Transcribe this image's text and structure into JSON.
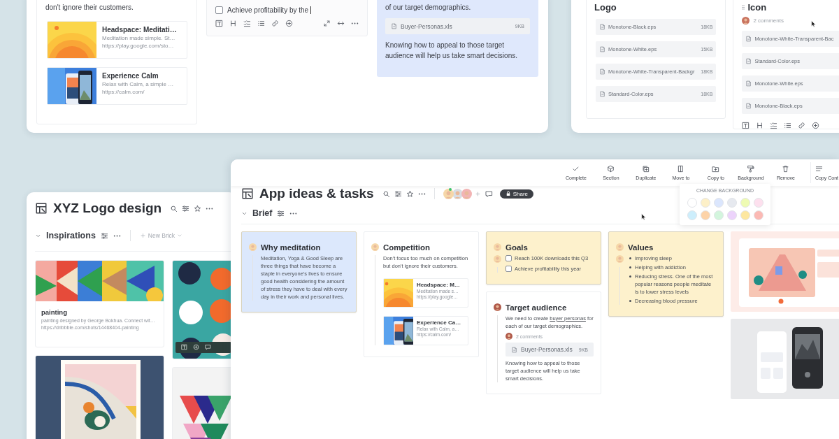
{
  "top_left_window": {
    "competition_card": {
      "text": "don't ignore their customers.",
      "links": [
        {
          "title": "Headspace: Meditati…",
          "description": "Meditation made simple. St…",
          "url": "https://play.google.com/sto…",
          "thumbnail": {
            "kind": "picture"
          }
        },
        {
          "title": "Experience Calm",
          "description": "Relax with Calm, a simple …",
          "url": "https://calm.com/",
          "thumbnail": {
            "kind": "picture"
          }
        }
      ]
    },
    "goals_card": {
      "tasks": [
        {
          "label": "Achieve profitability by the",
          "checked": false,
          "editing": true
        }
      ]
    },
    "target_card": {
      "color": "#dfe8fc",
      "text": "of our target demographics.",
      "attachment": {
        "name": "Buyer-Personas.xls",
        "size": "9KB"
      },
      "note": "Knowing how to appeal to those target audience will help us take smart decisions."
    }
  },
  "top_right_window": {
    "columns": [
      {
        "title": "Logo",
        "files": [
          {
            "name": "Monotone-Black.eps",
            "size": "18KB"
          },
          {
            "name": "Monotone-White.eps",
            "size": "15KB"
          },
          {
            "name": "Monotone-White-Transparent-Backgr",
            "size": "18KB"
          },
          {
            "name": "Standard-Color.eps",
            "size": "18KB"
          }
        ]
      },
      {
        "title": "Icon",
        "comments": "2 comments",
        "files": [
          {
            "name": "Monotone-White-Transparent-Bac"
          },
          {
            "name": "Standard-Color.eps"
          },
          {
            "name": "Monotone-White.eps"
          },
          {
            "name": "Monotone-Black.eps"
          }
        ]
      }
    ]
  },
  "logo_window": {
    "title": "XYZ Logo design",
    "section": "Inspirations",
    "new_brick": "New Brick",
    "columns": [
      [
        {
          "kind": "link",
          "title": "painting",
          "description": "painting designed by George Bokhua. Connect wit…",
          "url": "https://dribbble.com/shots/14468404-painting"
        },
        {
          "kind": "picture"
        }
      ],
      [
        {
          "kind": "picture"
        },
        {
          "kind": "picture"
        }
      ]
    ]
  },
  "main_window": {
    "toolbar": [
      {
        "label": "Complete"
      },
      {
        "label": "Section"
      },
      {
        "label": "Duplicate"
      },
      {
        "label": "Move to"
      },
      {
        "label": "Copy to"
      },
      {
        "label": "Background"
      },
      {
        "label": "Remove"
      },
      {
        "label": "Copy Cont"
      }
    ],
    "title": "App ideas & tasks",
    "share": "Share",
    "background_menu": {
      "title": "CHANGE BACKGROUND",
      "swatches": [
        {
          "color": "#ffffff"
        },
        {
          "color": "#fdf0c8"
        },
        {
          "color": "#dbe6fd"
        },
        {
          "color": "#e6e9ef"
        },
        {
          "color": "#eefbb3"
        },
        {
          "color": "#fde0ee"
        },
        {
          "color": "#cdeefc"
        },
        {
          "color": "#fdd3a8"
        },
        {
          "color": "#d3f5dd"
        },
        {
          "color": "#ecd3fb"
        },
        {
          "color": "#fde7a0"
        },
        {
          "color": "#fbb9b4"
        }
      ]
    },
    "section": "Brief",
    "columns": [
      [
        {
          "kind": "text",
          "color": "#dce8fc",
          "title": "Why meditation",
          "text": "Meditation, Yoga & Good Sleep are three things that have become a staple in everyone's lives to ensure good health considering the amount of stress they have to deal with every day in their work and personal lives."
        }
      ],
      [
        {
          "kind": "links",
          "color": "#ffffff",
          "title": "Competition",
          "text": "Don't focus too much on competition but don't ignore their customers.",
          "links": [
            {
              "title": "Headspace: M…",
              "description": "Meditation made s…",
              "url": "https://play.google…",
              "thumbnail": {
                "kind": "picture"
              }
            },
            {
              "title": "Experience Ca…",
              "description": "Relax with Calm, a…",
              "url": "https://calm.com/",
              "thumbnail": {
                "kind": "picture"
              }
            }
          ]
        }
      ],
      [
        {
          "kind": "tasks",
          "color": "#fdf1cc",
          "title": "Goals",
          "tasks": [
            {
              "label": "Reach 100K downloads this Q3",
              "checked": false
            },
            {
              "label": "Achieve profitability this year",
              "checked": false
            }
          ]
        },
        {
          "kind": "audience",
          "color": "#ffffff",
          "title": "Target audience",
          "text_before": "We need to create",
          "link": "buyer personas",
          "text_after": "for each of our target demographics.",
          "comments": "2 comments",
          "attachment": {
            "name": "Buyer-Personas.xls",
            "size": "9KB"
          },
          "note": "Knowing how to appeal to those target audience will help us take smart decisions."
        }
      ],
      [
        {
          "kind": "bullets",
          "color": "#fdf1cc",
          "title": "Values",
          "items": [
            "Improving sleep",
            "Helping with addiction",
            "Reducing stress. One of the most popular reasons people meditate is to lower stress levels",
            "Decreasing blood pressure"
          ]
        }
      ],
      [
        {
          "kind": "picture",
          "color": "#fdece8"
        },
        {
          "kind": "picture",
          "color": "#e8e9eb"
        }
      ]
    ]
  }
}
